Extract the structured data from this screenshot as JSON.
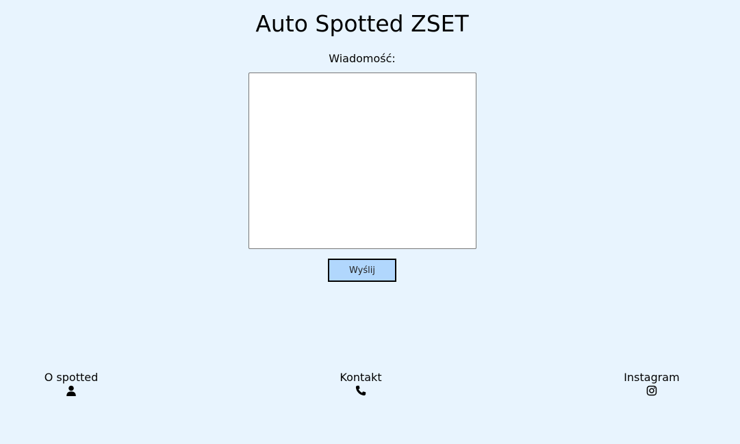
{
  "header": {
    "title": "Auto Spotted ZSET"
  },
  "form": {
    "message_label": "Wiadomość:",
    "message_value": "",
    "send_label": "Wyślij"
  },
  "footer": {
    "items": [
      {
        "label": "O spotted",
        "icon": "person-icon"
      },
      {
        "label": "Kontakt",
        "icon": "phone-icon"
      },
      {
        "label": "Instagram",
        "icon": "instagram-icon"
      }
    ]
  },
  "colors": {
    "background": "#e8f4fe",
    "button": "#b1d7fd"
  }
}
